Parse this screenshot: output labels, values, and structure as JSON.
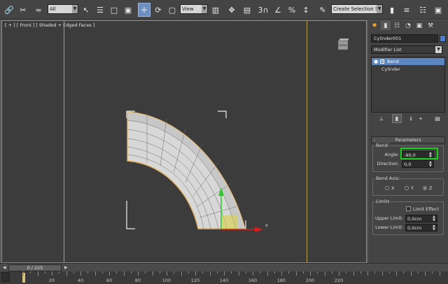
{
  "toolbar": {
    "selection_filter": "All",
    "reference_coord": "View",
    "snap_label": "3",
    "named_selection": "Create Selection Se"
  },
  "viewport": {
    "label": "[ + ] [ Front ] [ Shaded + Edged Faces ]",
    "viewcube_label": "FRONT",
    "gizmo_x_label": "x"
  },
  "command_panel": {
    "object_name": "Cylinder001",
    "object_color": "#4a7ed4",
    "modifier_list": "Modifier List",
    "stack": [
      {
        "label": "Bend",
        "selected": true
      },
      {
        "label": "Cylinder",
        "selected": false
      }
    ],
    "parameters": {
      "rollout_title": "Parameters",
      "bend_group": "Bend:",
      "angle_label": "Angle:",
      "angle_value": "-90,0",
      "direction_label": "Direction:",
      "direction_value": "0,0",
      "axis_group": "Bend Axis:",
      "axis_options": [
        "X",
        "Y",
        "Z"
      ],
      "axis_selected": "Z",
      "limits_group": "Limits",
      "limit_effect_label": "Limit Effect",
      "limit_effect_checked": false,
      "upper_limit_label": "Upper Limit:",
      "upper_limit_value": "0,0cm",
      "lower_limit_label": "Lower Limit:",
      "lower_limit_value": "0,0cm"
    }
  },
  "timeline": {
    "frame_display": "0 / 225",
    "ticks": [
      "20",
      "40",
      "60",
      "80",
      "100",
      "120",
      "140",
      "160",
      "180",
      "200",
      "220"
    ]
  },
  "colors": {
    "accent": "#6d8fbf",
    "highlight": "#18d018",
    "safe_frame": "#b8a24a"
  }
}
